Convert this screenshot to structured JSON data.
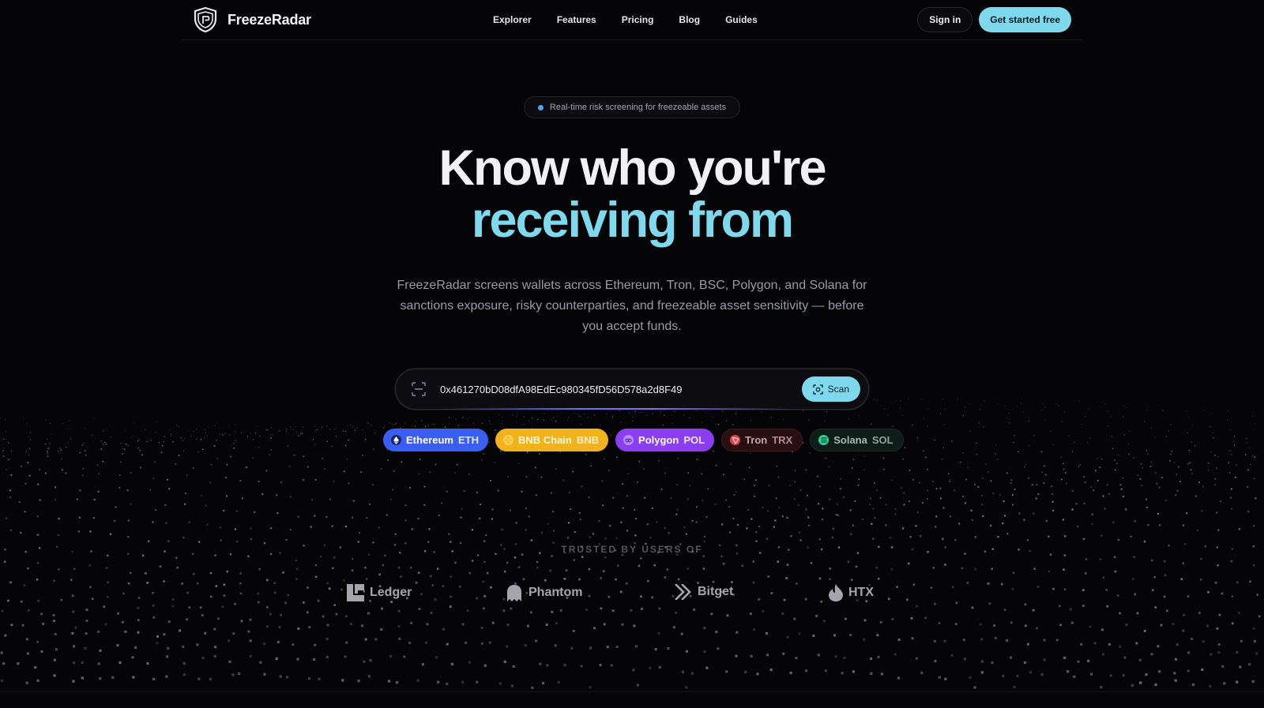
{
  "brand": {
    "name": "FreezeRadar"
  },
  "nav": {
    "links": [
      "Explorer",
      "Features",
      "Pricing",
      "Blog",
      "Guides"
    ],
    "sign_in": "Sign in",
    "cta": "Get started free"
  },
  "badge": {
    "text": "Real-time risk screening for freezeable assets"
  },
  "hero": {
    "title_line1": "Know who you're",
    "title_line2": "receiving from",
    "subtitle": "FreezeRadar screens wallets across Ethereum, Tron, BSC, Polygon, and Solana for sanctions exposure, risky counterparties, and freezeable asset sensitivity — before you accept funds."
  },
  "search": {
    "value": "0x461270bD08dfA98EdEc980345fD56D578a2d8F49",
    "scan_label": "Scan"
  },
  "chains": [
    {
      "name": "Ethereum",
      "ticker": "ETH",
      "icon": "ethereum-icon"
    },
    {
      "name": "BNB Chain",
      "ticker": "BNB",
      "icon": "bnb-icon"
    },
    {
      "name": "Polygon",
      "ticker": "POL",
      "icon": "polygon-icon"
    },
    {
      "name": "Tron",
      "ticker": "TRX",
      "icon": "tron-icon"
    },
    {
      "name": "Solana",
      "ticker": "SOL",
      "icon": "solana-icon"
    }
  ],
  "trusted": {
    "label": "TRUSTED BY USERS OF",
    "logos": [
      "Ledger",
      "Phantom",
      "Bitget",
      "HTX"
    ]
  },
  "colors": {
    "background": "#050507",
    "accent": "#7fd9ec",
    "ethereum": "#3a5ef2",
    "bnb": "#f1b21b",
    "polygon": "#8b3ef0"
  }
}
